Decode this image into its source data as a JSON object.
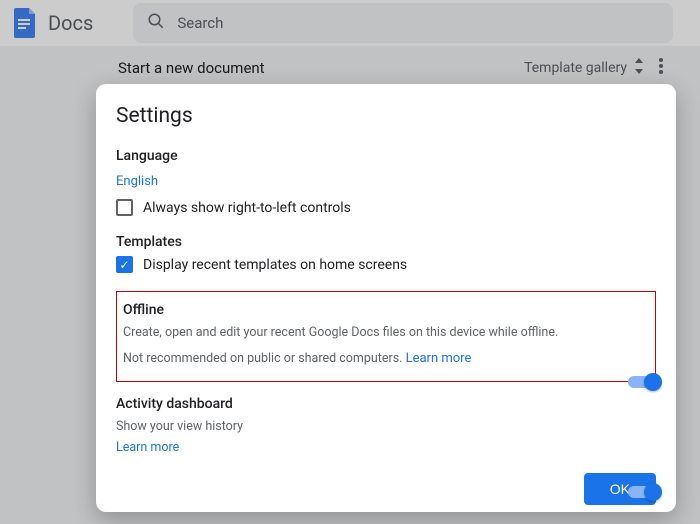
{
  "header": {
    "app_name": "Docs",
    "search_placeholder": "Search"
  },
  "templates": {
    "start_label": "Start a new document",
    "gallery_label": "Template gallery"
  },
  "modal": {
    "title": "Settings",
    "language": {
      "title": "Language",
      "value": "English",
      "rtl_label": "Always show right-to-left controls",
      "rtl_checked": false
    },
    "templates_section": {
      "title": "Templates",
      "display_label": "Display recent templates on home screens",
      "display_checked": true
    },
    "offline": {
      "title": "Offline",
      "desc1": "Create, open and edit your recent Google Docs files on this device while offline.",
      "desc2_prefix": "Not recommended on public or shared computers. ",
      "learn_more": "Learn more",
      "enabled": true
    },
    "activity": {
      "title": "Activity dashboard",
      "desc": "Show your view history",
      "learn_more": "Learn more",
      "enabled": true
    },
    "ok_label": "OK"
  }
}
